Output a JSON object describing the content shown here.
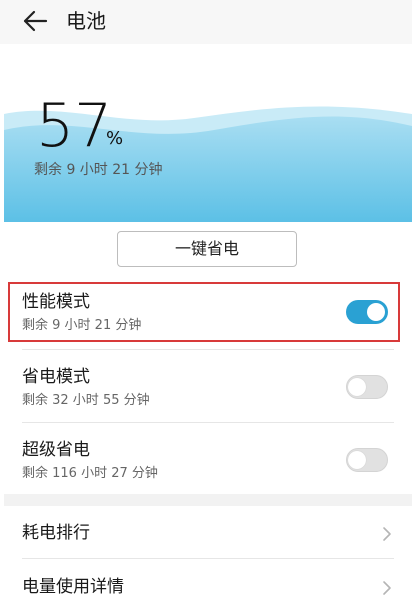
{
  "header": {
    "title": "电池"
  },
  "battery": {
    "percent": "57",
    "unit": "%",
    "remaining": "剩余 9 小时 21 分钟",
    "level": 0.57
  },
  "save_button": {
    "label": "一键省电"
  },
  "modes": [
    {
      "title": "性能模式",
      "subtitle": "剩余 9 小时 21 分钟",
      "enabled": true
    },
    {
      "title": "省电模式",
      "subtitle": "剩余 32 小时 55 分钟",
      "enabled": false
    },
    {
      "title": "超级省电",
      "subtitle": "剩余 116 小时 27 分钟",
      "enabled": false
    }
  ],
  "nav": [
    {
      "label": "耗电排行"
    },
    {
      "label": "电量使用详情"
    }
  ],
  "colors": {
    "accent": "#2aa1d3",
    "highlight": "#d83a3a",
    "wave_light": "#bfe4f4",
    "wave_dark": "#7fcdea"
  },
  "icons": {
    "back": "arrow-left-icon",
    "chevron": "chevron-right-icon"
  }
}
